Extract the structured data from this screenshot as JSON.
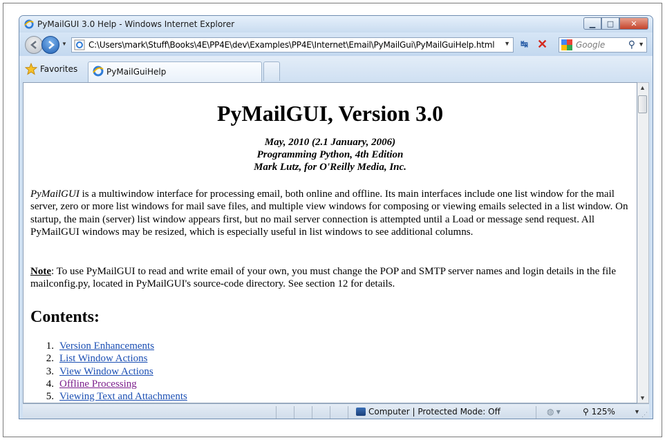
{
  "window": {
    "title": "PyMailGUI 3.0 Help - Windows Internet Explorer",
    "min_symbol": "▁",
    "max_symbol": "□",
    "close_symbol": "✕"
  },
  "address": {
    "url": "C:\\Users\\mark\\Stuff\\Books\\4E\\PP4E\\dev\\Examples\\PP4E\\Internet\\Email\\PyMailGui\\PyMailGuiHelp.html",
    "search_placeholder": "Google"
  },
  "favorites": {
    "label": "Favorites"
  },
  "tab": {
    "label": "PyMailGuiHelp"
  },
  "page": {
    "title": "PyMailGUI, Version 3.0",
    "subtitle_lines": [
      "May, 2010 (2.1 January, 2006)",
      "Programming Python, 4th Edition",
      "Mark Lutz, for O'Reilly Media, Inc."
    ],
    "intro_em": "PyMailGUI",
    "intro_rest": " is a multiwindow interface for processing email, both online and offline. Its main interfaces include one list window for the mail server, zero or more list windows for mail save files, and multiple view windows for composing or viewing emails selected in a list window. On startup, the main (server) list window appears first, but no mail server connection is attempted until a Load or message send request. All PyMailGUI windows may be resized, which is especially useful in list windows to see additional columns.",
    "note_label": "Note",
    "note_text": ": To use PyMailGUI to read and write email of your own, you must change the POP and SMTP server names and login details in the file mailconfig.py, located in PyMailGUI's source-code directory. See section 12 for details.",
    "contents_heading": "Contents:",
    "toc": [
      {
        "num": "1.",
        "label": "Version Enhancements"
      },
      {
        "num": "2.",
        "label": "List Window Actions"
      },
      {
        "num": "3.",
        "label": "View Window Actions"
      },
      {
        "num": "4.",
        "label": "Offline Processing"
      },
      {
        "num": "5.",
        "label": "Viewing Text and Attachments"
      }
    ]
  },
  "status": {
    "zone": "Computer | Protected Mode: Off",
    "zoom": "125%"
  },
  "colors": {
    "link": "#1a4eb3",
    "visited_link": "#7b1e8c",
    "chrome": "#cfe0f2"
  }
}
